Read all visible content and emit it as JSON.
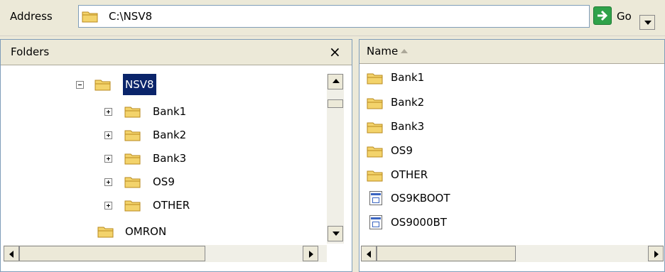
{
  "address_bar": {
    "label": "Address",
    "path": "C:\\NSV8",
    "go_label": "Go"
  },
  "folders": {
    "title": "Folders",
    "close_glyph": "×",
    "tree": [
      {
        "label": "NSV8",
        "expander": "minus",
        "selected": true
      },
      {
        "label": "Bank1",
        "expander": "plus"
      },
      {
        "label": "Bank2",
        "expander": "plus"
      },
      {
        "label": "Bank3",
        "expander": "plus"
      },
      {
        "label": "OS9",
        "expander": "plus"
      },
      {
        "label": "OTHER",
        "expander": "plus"
      },
      {
        "label": "OMRON",
        "expander": "none"
      }
    ]
  },
  "files": {
    "column_name": "Name",
    "items": [
      {
        "name": "Bank1",
        "icon": "folder-icon"
      },
      {
        "name": "Bank2",
        "icon": "folder-icon"
      },
      {
        "name": "Bank3",
        "icon": "folder-icon"
      },
      {
        "name": "OS9",
        "icon": "folder-icon"
      },
      {
        "name": "OTHER",
        "icon": "folder-icon"
      },
      {
        "name": "OS9KBOOT",
        "icon": "executable-icon"
      },
      {
        "name": "OS9000BT",
        "icon": "executable-icon"
      }
    ]
  },
  "colors": {
    "selection": "#0a246a",
    "go_green": "#2fa24a",
    "folder_yellow": "#f3d36b"
  }
}
